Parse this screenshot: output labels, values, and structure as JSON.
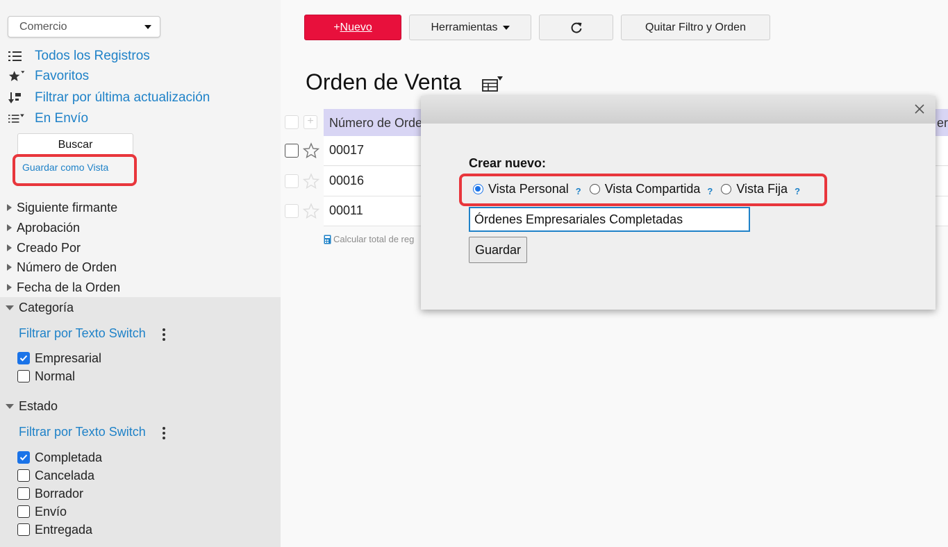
{
  "sidebar": {
    "app_select": "Comercio",
    "links": [
      {
        "icon": "list-icon",
        "label": "Todos los Registros"
      },
      {
        "icon": "star-filter-icon",
        "label": "Favoritos"
      },
      {
        "icon": "sort-icon",
        "label": "Filtrar por última actualización"
      },
      {
        "icon": "list-filter-icon",
        "label": "En Envío"
      }
    ],
    "search_label": "Buscar",
    "save_view_label": "Guardar como Vista",
    "tree": [
      {
        "label": "Siguiente firmante",
        "expanded": false
      },
      {
        "label": "Aprobación",
        "expanded": false
      },
      {
        "label": "Creado Por",
        "expanded": false
      },
      {
        "label": "Número de Orden",
        "expanded": false
      },
      {
        "label": "Fecha de la Orden",
        "expanded": false
      }
    ],
    "categoria": {
      "label": "Categoría",
      "filter_label": "Filtrar por Texto Switch",
      "options": [
        {
          "label": "Empresarial",
          "checked": true
        },
        {
          "label": "Normal",
          "checked": false
        }
      ]
    },
    "estado": {
      "label": "Estado",
      "filter_label": "Filtrar por Texto Switch",
      "options": [
        {
          "label": "Completada",
          "checked": true
        },
        {
          "label": "Cancelada",
          "checked": false
        },
        {
          "label": "Borrador",
          "checked": false
        },
        {
          "label": "Envío",
          "checked": false
        },
        {
          "label": "Entregada",
          "checked": false
        }
      ]
    }
  },
  "toolbar": {
    "new_prefix": "+",
    "new_label": "Nuevo",
    "tools_label": "Herramientas",
    "clear_label": "Quitar Filtro y Orden"
  },
  "main": {
    "title": "Orden de Venta",
    "column_header": "Número de Orde",
    "column_header_tail": "er",
    "rows": [
      "00017",
      "00016",
      "00011"
    ],
    "calc_total": "Calcular total de reg"
  },
  "dialog": {
    "create_label": "Crear nuevo:",
    "help_symbol": "?",
    "options": [
      {
        "label": "Vista Personal",
        "selected": true
      },
      {
        "label": "Vista Compartida",
        "selected": false
      },
      {
        "label": "Vista Fija",
        "selected": false
      }
    ],
    "view_name": "Órdenes Empresariales Completadas",
    "save_label": "Guardar"
  },
  "colors": {
    "accent": "#1f82c8",
    "new_button": "#e8103c",
    "highlight": "#e8363c",
    "header": "#d8d5f4"
  }
}
